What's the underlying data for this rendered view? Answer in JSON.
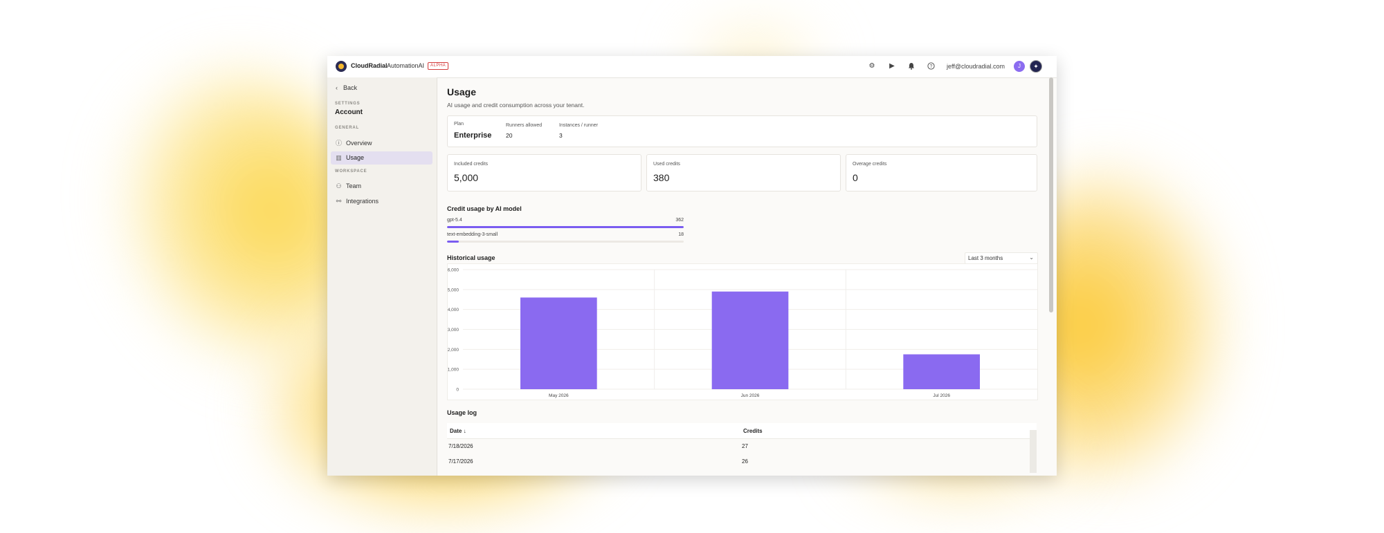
{
  "app": {
    "brand": "CloudRadial",
    "product": "AutomationAI",
    "badge": "ALPHA",
    "user_email": "jeff@cloudradial.com",
    "avatar_initial": "J"
  },
  "sidebar": {
    "back_label": "Back",
    "settings_label": "SETTINGS",
    "account_label": "Account",
    "general_label": "GENERAL",
    "workspace_label": "WORKSPACE",
    "items": [
      {
        "label": "Overview",
        "icon": "info-icon"
      },
      {
        "label": "Usage",
        "icon": "bar-chart-icon",
        "active": true
      },
      {
        "label": "Team",
        "icon": "users-icon"
      },
      {
        "label": "Integrations",
        "icon": "plug-icon"
      }
    ]
  },
  "page": {
    "title": "Usage",
    "subtitle": "AI usage and credit consumption across your tenant."
  },
  "plan": {
    "plan_label": "Plan",
    "plan_value": "Enterprise",
    "runners_label": "Runners allowed",
    "runners_value": "20",
    "instances_label": "Instances / runner",
    "instances_value": "3"
  },
  "credits": {
    "included_label": "Included credits",
    "included_value": "5,000",
    "used_label": "Used credits",
    "used_value": "380",
    "overage_label": "Overage credits",
    "overage_value": "0"
  },
  "model_usage": {
    "title": "Credit usage by AI model",
    "models": [
      {
        "name": "gpt-5.4",
        "value": "362",
        "fraction": 1.0
      },
      {
        "name": "text-embedding-3-small",
        "value": "18",
        "fraction": 0.05
      }
    ]
  },
  "historical": {
    "title": "Historical usage",
    "range_selected": "Last 3 months"
  },
  "chart_data": {
    "type": "bar",
    "title": "",
    "xlabel": "",
    "ylabel": "",
    "categories": [
      "May 2026",
      "Jun 2026",
      "Jul 2026"
    ],
    "values": [
      4600,
      4900,
      1750
    ],
    "ylim": [
      0,
      6000
    ],
    "yticks": [
      "6,000",
      "5,000",
      "4,000",
      "3,000",
      "2,000",
      "1,000",
      "0"
    ],
    "grid": true,
    "bar_color": "#8a6af0"
  },
  "usage_log": {
    "title": "Usage log",
    "columns": [
      "Date",
      "Credits"
    ],
    "rows": [
      {
        "date": "7/18/2026",
        "credits": "27"
      },
      {
        "date": "7/17/2026",
        "credits": "26"
      }
    ]
  },
  "colors": {
    "accent": "#7a5cf0",
    "sidebar_bg": "#f3f1ec",
    "active_nav": "#e4dff0",
    "badge": "#d43b3b"
  }
}
